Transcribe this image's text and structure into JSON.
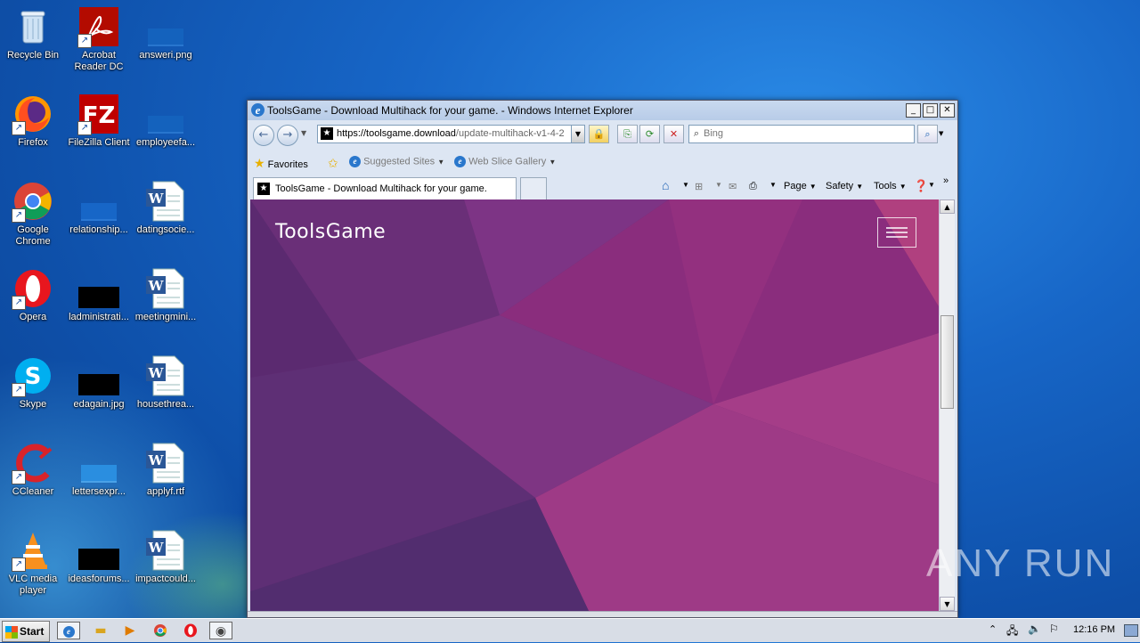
{
  "desktop": {
    "icons": [
      {
        "label": "Recycle Bin"
      },
      {
        "label": "Acrobat Reader DC"
      },
      {
        "label": "answeri.png"
      },
      {
        "label": "Firefox"
      },
      {
        "label": "FileZilla Client"
      },
      {
        "label": "employeefa..."
      },
      {
        "label": "Google Chrome"
      },
      {
        "label": "relationship..."
      },
      {
        "label": "datingsocie..."
      },
      {
        "label": "Opera"
      },
      {
        "label": "ladministrati..."
      },
      {
        "label": "meetingmini..."
      },
      {
        "label": "Skype"
      },
      {
        "label": "edagain.jpg"
      },
      {
        "label": "housethrea..."
      },
      {
        "label": "CCleaner"
      },
      {
        "label": "lettersexpr..."
      },
      {
        "label": "applyf.rtf"
      },
      {
        "label": "VLC media player"
      },
      {
        "label": "ideasforums..."
      },
      {
        "label": "impactcould..."
      }
    ]
  },
  "browser": {
    "title": "ToolsGame - Download Multihack for your game. - Windows Internet Explorer",
    "address_host": "https://toolsgame.download",
    "address_path": "/update-multihack-v1-4-2",
    "search_placeholder": "Bing",
    "favorites": {
      "favorites_label": "Favorites",
      "suggested_sites": "Suggested Sites",
      "web_slice_gallery": "Web Slice Gallery"
    },
    "tab_title": "ToolsGame - Download Multihack for your game.",
    "commands": {
      "page": "Page",
      "safety": "Safety",
      "tools": "Tools"
    },
    "page": {
      "brand": "ToolsGame"
    }
  },
  "taskbar": {
    "start_label": "Start",
    "clock": "12:16 PM"
  },
  "watermark": "ANY RUN"
}
